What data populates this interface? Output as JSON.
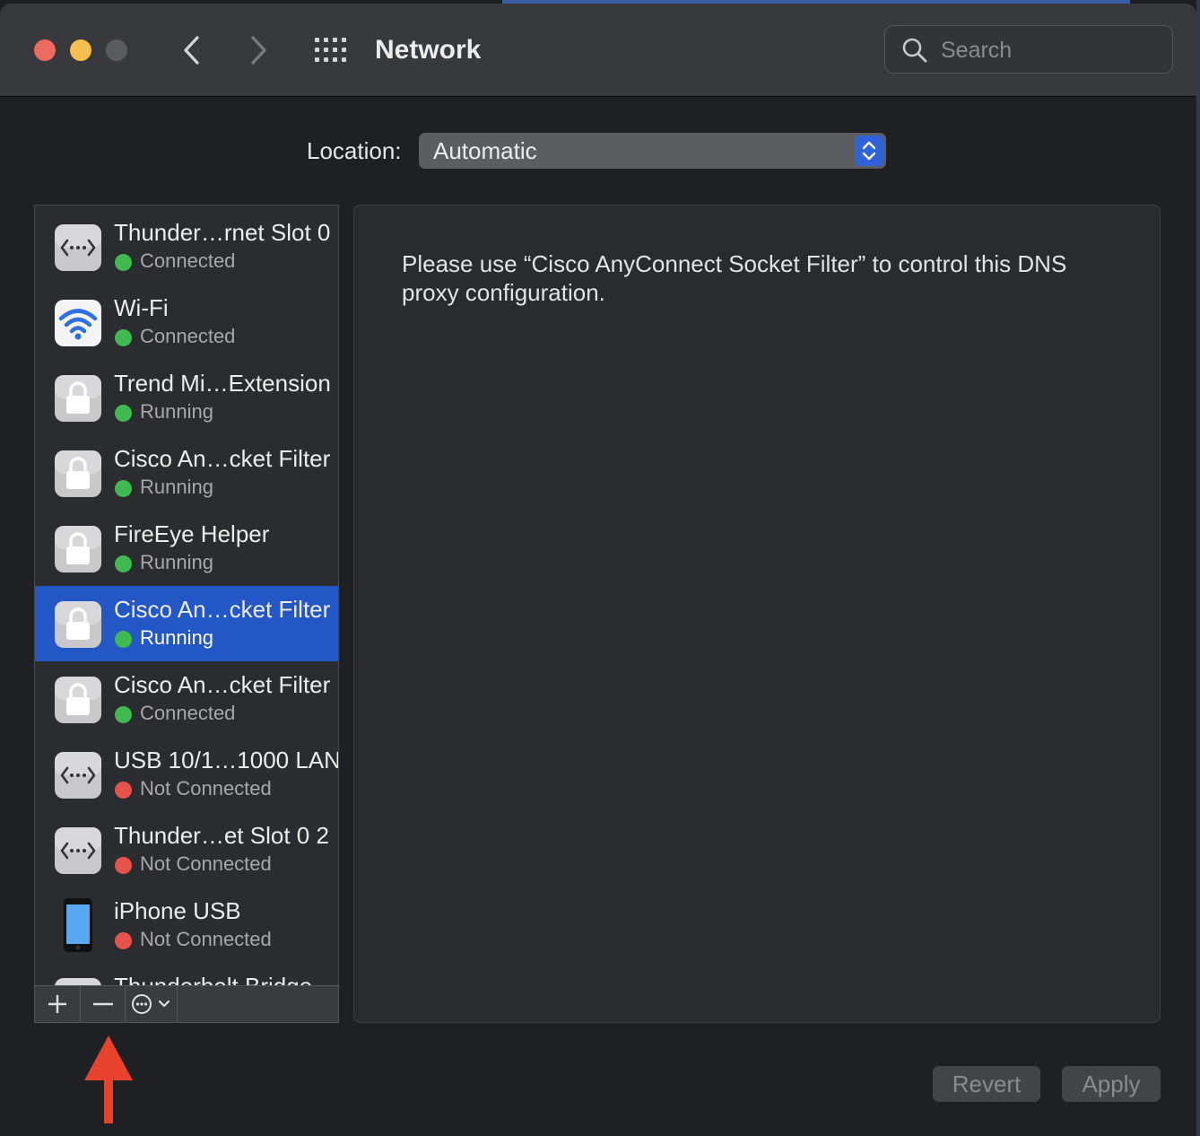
{
  "window": {
    "title": "Network",
    "search_placeholder": "Search"
  },
  "location": {
    "label": "Location:",
    "value": "Automatic"
  },
  "services": [
    {
      "name": "Thunder…rnet Slot 0",
      "status": "Connected",
      "status_color": "#3fb950",
      "icon": "ethernet-icon"
    },
    {
      "name": "Wi-Fi",
      "status": "Connected",
      "status_color": "#3fb950",
      "icon": "wifi-icon"
    },
    {
      "name": "Trend Mi…Extension",
      "status": "Running",
      "status_color": "#3fb950",
      "icon": "lock-icon"
    },
    {
      "name": "Cisco An…cket Filter",
      "status": "Running",
      "status_color": "#3fb950",
      "icon": "lock-icon"
    },
    {
      "name": "FireEye Helper",
      "status": "Running",
      "status_color": "#3fb950",
      "icon": "lock-icon"
    },
    {
      "name": "Cisco An…cket Filter",
      "status": "Running",
      "status_color": "#3fb950",
      "icon": "lock-icon",
      "selected": true
    },
    {
      "name": "Cisco An…cket Filter",
      "status": "Connected",
      "status_color": "#3fb950",
      "icon": "lock-icon"
    },
    {
      "name": "USB 10/1…1000 LAN",
      "status": "Not Connected",
      "status_color": "#e5534b",
      "icon": "ethernet-icon"
    },
    {
      "name": "Thunder…et Slot 0 2",
      "status": "Not Connected",
      "status_color": "#e5534b",
      "icon": "ethernet-icon"
    },
    {
      "name": "iPhone USB",
      "status": "Not Connected",
      "status_color": "#e5534b",
      "icon": "iphone-icon"
    },
    {
      "name": "Thunderbolt Bridge",
      "status": "",
      "status_color": "#3fb950",
      "icon": "ethernet-icon"
    }
  ],
  "toolbar": {
    "add_label": "+",
    "remove_label": "−"
  },
  "detail": {
    "message": "Please use “Cisco AnyConnect Socket Filter” to control this DNS proxy configuration."
  },
  "footer": {
    "revert_label": "Revert",
    "apply_label": "Apply"
  },
  "colors": {
    "accent": "#2357c5",
    "connected": "#3fb950",
    "not_connected": "#e5534b",
    "annotation_arrow": "#e8412c"
  }
}
